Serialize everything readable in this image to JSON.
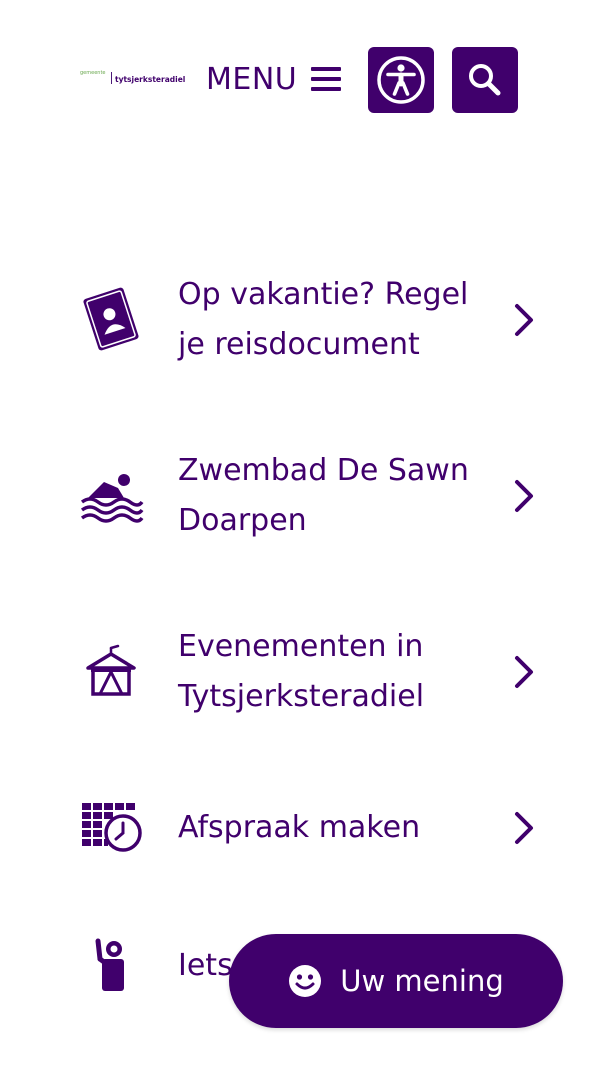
{
  "header": {
    "logo": {
      "top_text": "gemeente",
      "main_text": "tytsjerksteradiel"
    },
    "menu_label": "MENU",
    "accessibility_icon": "accessibility-icon",
    "search_icon": "search-icon"
  },
  "items": [
    {
      "label_line1": "Op vakantie? Regel",
      "label_line2": "je reisdocument",
      "icon": "passport-icon"
    },
    {
      "label_line1": "Zwembad De Sawn",
      "label_line2": "Doarpen",
      "icon": "swimmer-icon"
    },
    {
      "label_line1": "Evenementen in",
      "label_line2": "Tytsjerksteradiel",
      "icon": "tent-icon"
    },
    {
      "label_line1": "Afspraak maken",
      "label_line2": "",
      "icon": "calendar-clock-icon"
    },
    {
      "label_line1": "Iets",
      "label_line2": "",
      "icon": "person-question-icon"
    }
  ],
  "feedback": {
    "label": "Uw mening",
    "icon": "smiley-icon"
  },
  "colors": {
    "brand": "#40006c",
    "background": "#ffffff",
    "logo_green": "#6aa84f"
  }
}
